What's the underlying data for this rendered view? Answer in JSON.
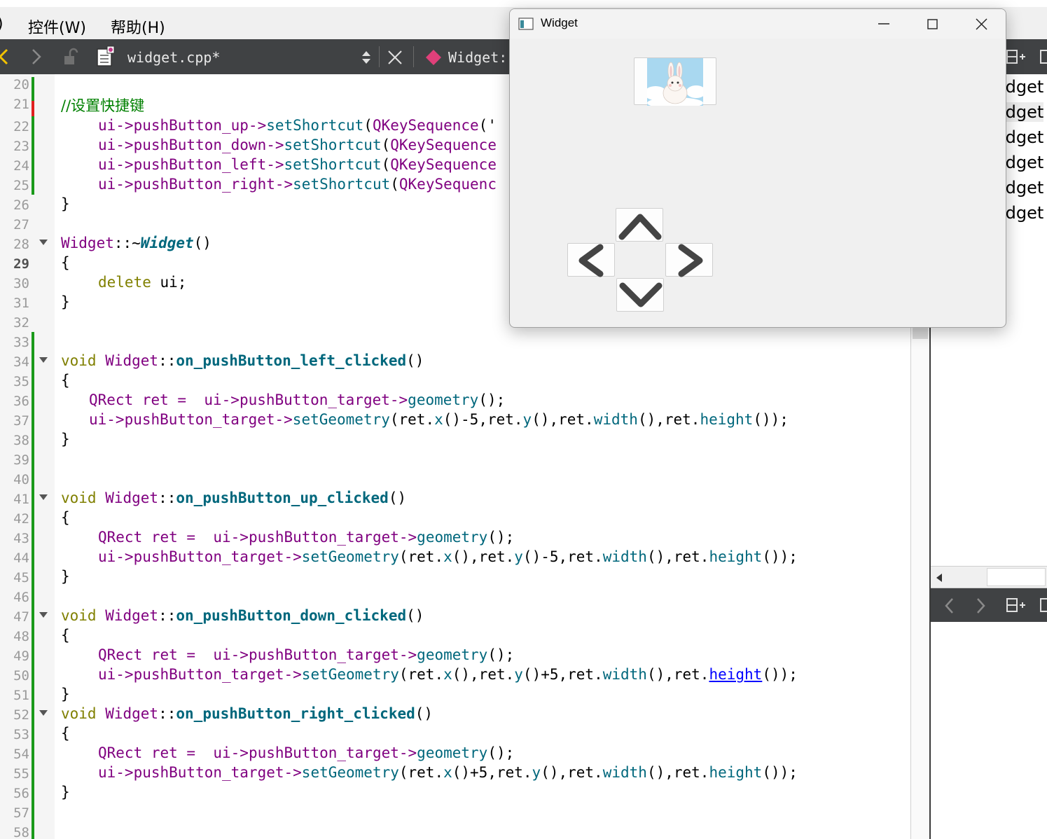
{
  "menu": {
    "items": [
      {
        "label": ")"
      },
      {
        "label": "控件(W)"
      },
      {
        "label": "帮助(H)"
      }
    ]
  },
  "toolbar": {
    "file_name": "widget.cpp*",
    "symbol_label": "Widget:"
  },
  "editor": {
    "current_line": 29,
    "lines": [
      {
        "n": "20"
      },
      {
        "n": "21"
      },
      {
        "n": "22"
      },
      {
        "n": "23"
      },
      {
        "n": "24"
      },
      {
        "n": "25"
      },
      {
        "n": "26"
      },
      {
        "n": "27"
      },
      {
        "n": "28"
      },
      {
        "n": "29"
      },
      {
        "n": "30"
      },
      {
        "n": "31"
      },
      {
        "n": "32"
      },
      {
        "n": "33"
      },
      {
        "n": "34"
      },
      {
        "n": "35"
      },
      {
        "n": "36"
      },
      {
        "n": "37"
      },
      {
        "n": "38"
      },
      {
        "n": "39"
      },
      {
        "n": "40"
      },
      {
        "n": "41"
      },
      {
        "n": "42"
      },
      {
        "n": "43"
      },
      {
        "n": "44"
      },
      {
        "n": "45"
      },
      {
        "n": "46"
      },
      {
        "n": "47"
      },
      {
        "n": "48"
      },
      {
        "n": "49"
      },
      {
        "n": "50"
      },
      {
        "n": "51"
      },
      {
        "n": "52"
      },
      {
        "n": "53"
      },
      {
        "n": "54"
      },
      {
        "n": "55"
      },
      {
        "n": "56"
      },
      {
        "n": "57"
      },
      {
        "n": "58"
      }
    ],
    "code": {
      "l21": "//设置快捷键",
      "l22_a": "ui->pushButton_up->",
      "l22_b": "setShortcut",
      "l22_c": "(",
      "l22_d": "QKeySequence",
      "l22_e": "('",
      "l23_a": "ui->pushButton_down->",
      "l23_b": "setShortcut",
      "l23_c": "(",
      "l23_d": "QKeySequence",
      "l24_a": "ui->pushButton_left->",
      "l24_b": "setShortcut",
      "l24_c": "(",
      "l24_d": "QKeySequence",
      "l25_a": "ui->pushButton_right->",
      "l25_b": "setShortcut",
      "l25_c": "(",
      "l25_d": "QKeySequenc",
      "brace_close": "}",
      "brace_open": "{",
      "l28_a": "Widget",
      "l28_b": "::~",
      "l28_c": "Widget",
      "l28_d": "()",
      "l30_a": "delete",
      "l30_b": " ui;",
      "kw_void": "void",
      "cls_widget": " Widget",
      "scope": "::",
      "fn_left": "on_pushButton_left_clicked",
      "fn_up": "on_pushButton_up_clicked",
      "fn_down": "on_pushButton_down_clicked",
      "fn_right": "on_pushButton_right_clicked",
      "parens": "()",
      "qrect": "QRect",
      "ret_assign": " ret =  ",
      "ui_target": "ui->pushButton_target->",
      "geometry": "geometry",
      "semi_call": "();",
      "setgeo": "setGeometry",
      "l37_tail_a": "(ret.",
      "x": "x",
      "l37_tail_b": "()-5,ret.",
      "y": "y",
      "l37_tail_c": "(),ret.",
      "width": "width",
      "l37_tail_d": "(),ret.",
      "height": "height",
      "l37_tail_e": "());",
      "l44_b": "(),ret.",
      "l44_c": "()-5,ret.",
      "l50_c": "()+5,ret.",
      "l55_b": "()+5,ret."
    }
  },
  "right_panel": {
    "items": [
      "idget",
      "idget",
      "idget",
      "idget",
      "idget",
      "idget"
    ]
  },
  "widget_window": {
    "title": "Widget"
  }
}
